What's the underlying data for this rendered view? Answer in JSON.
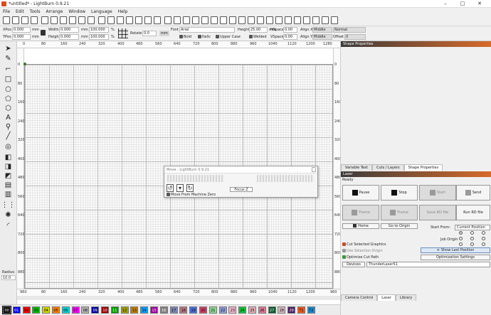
{
  "window": {
    "title": "*untitled* - LightBurn 0.9.21",
    "minimize": "–",
    "maximize": "□",
    "close": "✕"
  },
  "menu": [
    "File",
    "Edit",
    "Tools",
    "Arrange",
    "Window",
    "Language",
    "Help"
  ],
  "props": {
    "xpos_label": "XPos",
    "xpos": "0.000",
    "ypos_label": "YPos",
    "ypos": "0.000",
    "unit_mm": "mm",
    "width_label": "Width",
    "width": "0.000",
    "height_label": "Height",
    "height": "0.000",
    "pct1": "100.000",
    "pct2": "100.000",
    "pct_sign": "%",
    "rotate_label": "Rotate",
    "rotate": "0.0",
    "font_label": "Font",
    "font": "Arial",
    "fheight_label": "Height",
    "fheight": "25.00",
    "hspace_label": "HSpace",
    "hspace": "0.00",
    "vspace_label": "VSpace",
    "vspace": "0.00",
    "alignx_label": "Align X",
    "alignx": "Middle",
    "aligny_label": "Align Y",
    "aligny": "Middle",
    "normal": "Normal",
    "offset_label": "Offset",
    "offset": "0",
    "bold": "Bold",
    "italic": "Italic",
    "upper": "Upper Case",
    "welded": "Welded"
  },
  "left_tools": {
    "radius_label": "Radius:",
    "radius": "10.0"
  },
  "rulers": {
    "x": [
      "0",
      "80",
      "160",
      "240",
      "320",
      "400",
      "480",
      "560",
      "640",
      "720",
      "800",
      "880",
      "960",
      "1040",
      "1120",
      "1200",
      "1280"
    ],
    "y": [
      "960",
      "880",
      "800",
      "720",
      "640",
      "560",
      "480",
      "400",
      "320",
      "240",
      "160",
      "80",
      "0"
    ],
    "y_right": [
      "960",
      "880",
      "800",
      "720",
      "640",
      "560",
      "480",
      "400",
      "320",
      "240",
      "160",
      "80",
      "0"
    ],
    "bottom_x": [
      "0",
      "80",
      "160",
      "240",
      "320",
      "400",
      "480",
      "560",
      "640",
      "720",
      "800",
      "880",
      "960",
      "1040",
      "1120",
      "1200",
      "1280"
    ],
    "corner_bl": "960",
    "corner_br": "960"
  },
  "move_dialog": {
    "title": "Move - LightBurn 0.9.21",
    "focus": "Focus Z",
    "move_from_zero": "Move From Machine Zero"
  },
  "shape_properties": {
    "header": "Shape Properties"
  },
  "right_tabs": [
    "Variable Text",
    "Cuts / Layers",
    "Shape Properties"
  ],
  "laser": {
    "header": "Laser",
    "status": "Ready",
    "pause": "Pause",
    "stop": "Stop",
    "start": "Start",
    "send": "Send",
    "frame1": "Frame",
    "frame2": "Frame",
    "save_rd": "Save RD file",
    "run_rd": "Run RD file",
    "home": "Home",
    "go_origin": "Go to Origin",
    "start_from_label": "Start From:",
    "start_from": "Current Position",
    "job_origin_label": "Job Origin",
    "cut_selected": "Cut Selected Graphics",
    "use_selection_origin": "Use Selection Origin",
    "optimize": "Optimize Cut Path",
    "show_last": "Show Last Position",
    "opt_settings": "Optimization Settings",
    "devices": "Devices",
    "device": "ThunderLaser51"
  },
  "bottom_tabs": [
    "Camera Control",
    "Laser",
    "Library"
  ],
  "palette": [
    {
      "label": "00",
      "color": "#000000"
    },
    {
      "label": "01",
      "color": "#0000ff"
    },
    {
      "label": "02",
      "color": "#ff0000"
    },
    {
      "label": "03",
      "color": "#00c000"
    },
    {
      "label": "04",
      "color": "#d8d800"
    },
    {
      "label": "05",
      "color": "#ff8000"
    },
    {
      "label": "06",
      "color": "#00d8d8"
    },
    {
      "label": "07",
      "color": "#ff00ff"
    },
    {
      "label": "08",
      "color": "#b4b4b4"
    },
    {
      "label": "09",
      "color": "#0000a0"
    },
    {
      "label": "10",
      "color": "#a00000"
    },
    {
      "label": "11",
      "color": "#00a000"
    },
    {
      "label": "12",
      "color": "#a0a000"
    },
    {
      "label": "13",
      "color": "#c08000"
    },
    {
      "label": "14",
      "color": "#00a0ff"
    },
    {
      "label": "15",
      "color": "#a000a0"
    },
    {
      "label": "16",
      "color": "#808080"
    },
    {
      "label": "17",
      "color": "#7d87b9"
    },
    {
      "label": "18",
      "color": "#bb7784"
    },
    {
      "label": "19",
      "color": "#4a6fe3"
    },
    {
      "label": "20",
      "color": "#d33f6a"
    },
    {
      "label": "21",
      "color": "#8cd78f"
    },
    {
      "label": "22",
      "color": "#8e9cd8"
    },
    {
      "label": "23",
      "color": "#f5b4cb"
    },
    {
      "label": "24",
      "color": "#11c638"
    },
    {
      "label": "25",
      "color": "#e6afb9"
    },
    {
      "label": "26",
      "color": "#e07b91"
    },
    {
      "label": "27",
      "color": "#0f5a2a"
    },
    {
      "label": "28",
      "color": "#d6bcc0"
    },
    {
      "label": "29",
      "color": "#4c1b66"
    },
    {
      "label": "T1",
      "color": "#f35a1c"
    },
    {
      "label": "T2",
      "color": "#1e8cd2"
    }
  ]
}
